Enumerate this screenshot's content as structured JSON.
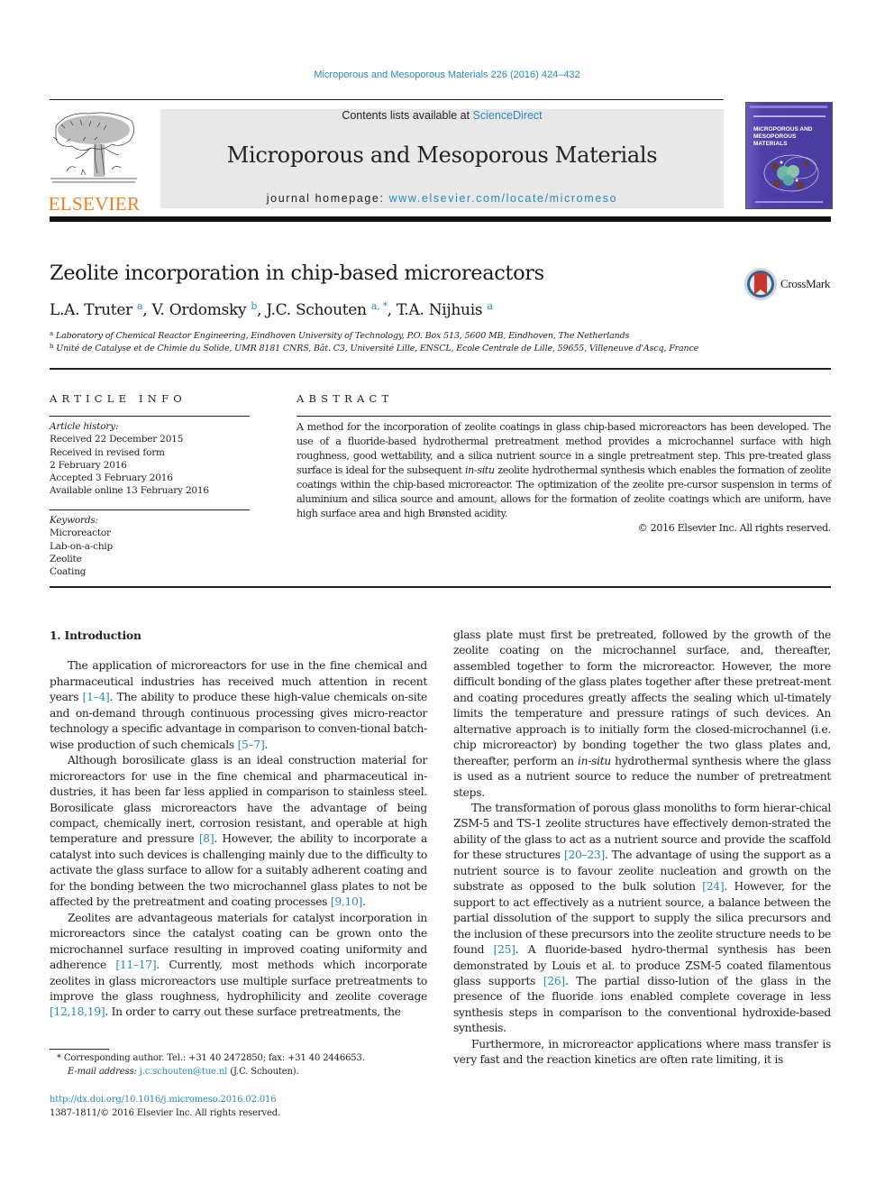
{
  "header": {
    "citation": "Microporous and Mesoporous Materials 226 (2016) 424–432",
    "contents_prefix": "Contents lists available at ",
    "contents_link": "ScienceDirect",
    "journal_name": "Microporous and Mesoporous Materials",
    "homepage_prefix": "journal homepage: ",
    "homepage_link": "www.elsevier.com/locate/micromeso",
    "publisher_logo_text": "ELSEVIER",
    "cover_title": "MICROPOROUS AND MESOPOROUS MATERIALS",
    "colors": {
      "link": "#2a8ab8",
      "elsevier_orange": "#f47b20",
      "cover_purple": "#4a3ca0",
      "masthead_gray": "#e8e8e8"
    }
  },
  "article": {
    "title": "Zeolite incorporation in chip-based microreactors",
    "crossmark_label": "CrossMark",
    "authors": [
      {
        "name": "L.A. Truter",
        "sup": "a",
        "sep": ", "
      },
      {
        "name": "V. Ordomsky",
        "sup": "b",
        "sep": ", "
      },
      {
        "name": "J.C. Schouten",
        "sup": "a, *",
        "sep": ", "
      },
      {
        "name": "T.A. Nijhuis",
        "sup": "a",
        "sep": ""
      }
    ],
    "affiliations": [
      {
        "key": "a",
        "text": "Laboratory of Chemical Reactor Engineering, Eindhoven University of Technology, P.O. Box 513, 5600 MB, Eindhoven, The Netherlands"
      },
      {
        "key": "b",
        "text": "Unité de Catalyse et de Chimie du Solide, UMR 8181 CNRS, Bât. C3, Université Lille, ENSCL, Ecole Centrale de Lille, 59655, Villeneuve d'Ascq, France"
      }
    ]
  },
  "article_info": {
    "label": "ARTICLE INFO",
    "history_head": "Article history:",
    "history": [
      "Received 22 December 2015",
      "Received in revised form",
      "2 February 2016",
      "Accepted 3 February 2016",
      "Available online 13 February 2016"
    ],
    "keywords_head": "Keywords:",
    "keywords": [
      "Microreactor",
      "Lab-on-a-chip",
      "Zeolite",
      "Coating"
    ]
  },
  "abstract": {
    "label": "ABSTRACT",
    "text_1": "A method for the incorporation of zeolite coatings in glass chip-based microreactors has been developed. The use of a fluoride-based hydrothermal pretreatment method provides a microchannel surface with high roughness, good wettability, and a silica nutrient source in a single pretreatment step. This pre-treated glass surface is ideal for the subsequent ",
    "text_italic": "in-situ",
    "text_2": " zeolite hydrothermal synthesis which enables the formation of zeolite coatings within the chip-based microreactor. The optimization of the zeolite pre-cursor suspension in terms of aluminium and silica source and amount, allows for the formation of zeolite coatings which are uniform, have high surface area and high Brønsted acidity.",
    "copyright": "© 2016 Elsevier Inc. All rights reserved."
  },
  "body": {
    "section_heading": "1.  Introduction",
    "p1": {
      "t1": "The application of microreactors for use in the fine chemical and pharmaceutical industries has received much attention in recent years ",
      "r1": "[1–4]",
      "t2": ". The ability to produce these high-value chemicals on-site and on-demand through continuous processing gives micro-reactor technology a specific advantage in comparison to conven-tional batch-wise production of such chemicals ",
      "r2": "[5–7]",
      "t3": "."
    },
    "p2": {
      "t1": "Although borosilicate glass is an ideal construction material for microreactors for use in the fine chemical and pharmaceutical in-dustries, it has been far less applied in comparison to stainless steel. Borosilicate glass microreactors have the advantage of being compact, chemically inert, corrosion resistant, and operable at high temperature and pressure ",
      "r1": "[8]",
      "t2": ". However, the ability to incorporate a catalyst into such devices is challenging mainly due to the difficulty to activate the glass surface to allow for a suitably adherent coating and for the bonding between the two microchannel glass plates to not be affected by the pretreatment and coating processes ",
      "r2": "[9,10]",
      "t3": "."
    },
    "p3": {
      "t1": "Zeolites are advantageous materials for catalyst incorporation in microreactors since the catalyst coating can be grown onto the microchannel surface resulting in improved coating uniformity and adherence ",
      "r1": "[11–17]",
      "t2": ". Currently, most methods which incorporate zeolites in glass microreactors use multiple surface pretreatments to improve the glass roughness, hydrophilicity and zeolite coverage ",
      "r2": "[12,18,19]",
      "t3": ". In order to carry out these surface pretreatments, the"
    },
    "p4": {
      "t1": "glass plate must first be pretreated, followed by the growth of the zeolite coating on the microchannel surface, and, thereafter, assembled together to form the microreactor. However, the more difficult bonding of the glass plates together after these pretreat-ment and coating procedures greatly affects the sealing which ul-timately limits the temperature and pressure ratings of such devices. An alternative approach is to initially form the closed-microchannel (i.e. chip microreactor) by bonding together the two glass plates and, thereafter, perform an ",
      "italic": "in-situ",
      "t2": " hydrothermal synthesis where the glass is used as a nutrient source to reduce the number of pretreatment steps."
    },
    "p5": {
      "t1": "The transformation of porous glass monoliths to form hierar-chical ZSM-5 and TS-1 zeolite structures have effectively demon-strated the ability of the glass to act as a nutrient source and provide the scaffold for these structures ",
      "r1": "[20–23]",
      "t2": ". The advantage of using the support as a nutrient source is to favour zeolite nucleation and growth on the substrate as opposed to the bulk solution ",
      "r2": "[24]",
      "t3": ". However, for the support to act effectively as a nutrient source, a balance between the partial dissolution of the support to supply the silica precursors and the inclusion of these precursors into the zeolite structure needs to be found ",
      "r3": "[25]",
      "t4": ". A fluoride-based hydro-thermal synthesis has been demonstrated by Louis et al. to produce ZSM-5 coated filamentous glass supports ",
      "r4": "[26]",
      "t5": ". The partial disso-lution of the glass in the presence of the fluoride ions enabled complete coverage in less synthesis steps in comparison to the conventional hydroxide-based synthesis."
    },
    "p6": {
      "t1": "Furthermore, in microreactor applications where mass transfer is very fast and the reaction kinetics are often rate limiting, it is"
    }
  },
  "footnote": {
    "star": "*",
    "corresponding": " Corresponding author. Tel.: +31 40 2472850; fax: +31 40 2446653.",
    "email_label": "E-mail address:",
    "email": "j.c.schouten@tue.nl",
    "email_owner": " (J.C. Schouten).",
    "doi": "http://dx.doi.org/10.1016/j.micromeso.2016.02.016",
    "issn_copyright": "1387-1811/© 2016 Elsevier Inc. All rights reserved."
  }
}
